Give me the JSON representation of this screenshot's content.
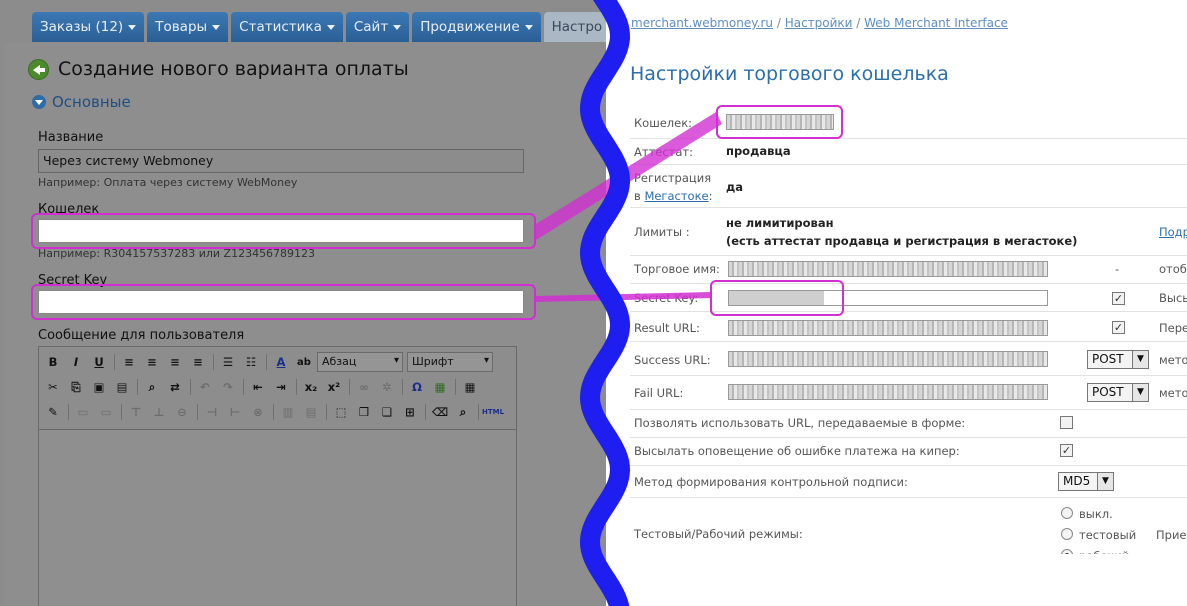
{
  "left": {
    "tabs": [
      {
        "label": "Заказы (12)",
        "caret": true
      },
      {
        "label": "Товары",
        "caret": true
      },
      {
        "label": "Статистика",
        "caret": true
      },
      {
        "label": "Сайт",
        "caret": true
      },
      {
        "label": "Продвижение",
        "caret": true
      },
      {
        "label": "Настро",
        "caret": false
      }
    ],
    "page_title": "Создание нового варианта оплаты",
    "section_title": "Основные",
    "name_label": "Название",
    "name_value": "Через систему Webmoney",
    "name_hint": "Например: Оплата через систему WebMoney",
    "wallet_label": "Кошелек",
    "wallet_hint": "Например: R304157537283 или Z123456789123",
    "secret_label": "Secret Key",
    "message_label": "Сообщение для пользователя",
    "editor": {
      "format_select": "Абзац",
      "font_select": "Шрифт",
      "html_label": "HTML"
    }
  },
  "right": {
    "breadcrumb": {
      "site": "merchant.webmoney.ru",
      "sep": " / ",
      "settings": "Настройки",
      "interface": "Web Merchant Interface"
    },
    "title": "Настройки торгового кошелька",
    "rows": {
      "wallet": "Кошелек:",
      "attestat": "Аттестат:",
      "attestat_value": "продавца",
      "registration_1": "Регистрация",
      "registration_2": "в",
      "registration_link": "Мегастоке",
      "registration_colon": ":",
      "registration_value": "да",
      "limits": "Лимиты :",
      "limits_value_1": "не лимитирован",
      "limits_value_2": "(есть аттестат продавца и регистрация в мегастоке)",
      "limits_link": "Подр",
      "trade_name": "Торговое имя:",
      "trade_dash": "-",
      "trade_clip": "отобр",
      "secret_key": "Secret Key:",
      "secret_clip": "Высы",
      "result_url": "Result URL:",
      "result_clip": "Пере",
      "success_url": "Success URL:",
      "success_method": "POST",
      "success_clip": "мето",
      "fail_url": "Fail URL:",
      "fail_method": "POST",
      "fail_clip": "мето",
      "allow_urls": "Позволять использовать URL, передаваемые в форме:",
      "send_error": "Высылать оповещение об ошибке платежа на кипер:",
      "sign_method": "Метод формирования контрольной подписи:",
      "sign_value": "MD5",
      "mode": "Тестовый/Рабочий режимы:",
      "mode_off": "выкл.",
      "mode_test": "тестовый",
      "mode_work": "рабочий",
      "mode_clip": "Прие"
    },
    "checks": {
      "secret_key": true,
      "result_url": true,
      "allow_urls": false,
      "send_error": true
    }
  },
  "colors": {
    "highlight": "#d22fd2",
    "wave": "#1e1ef0",
    "tab": "#2f6ca5"
  }
}
